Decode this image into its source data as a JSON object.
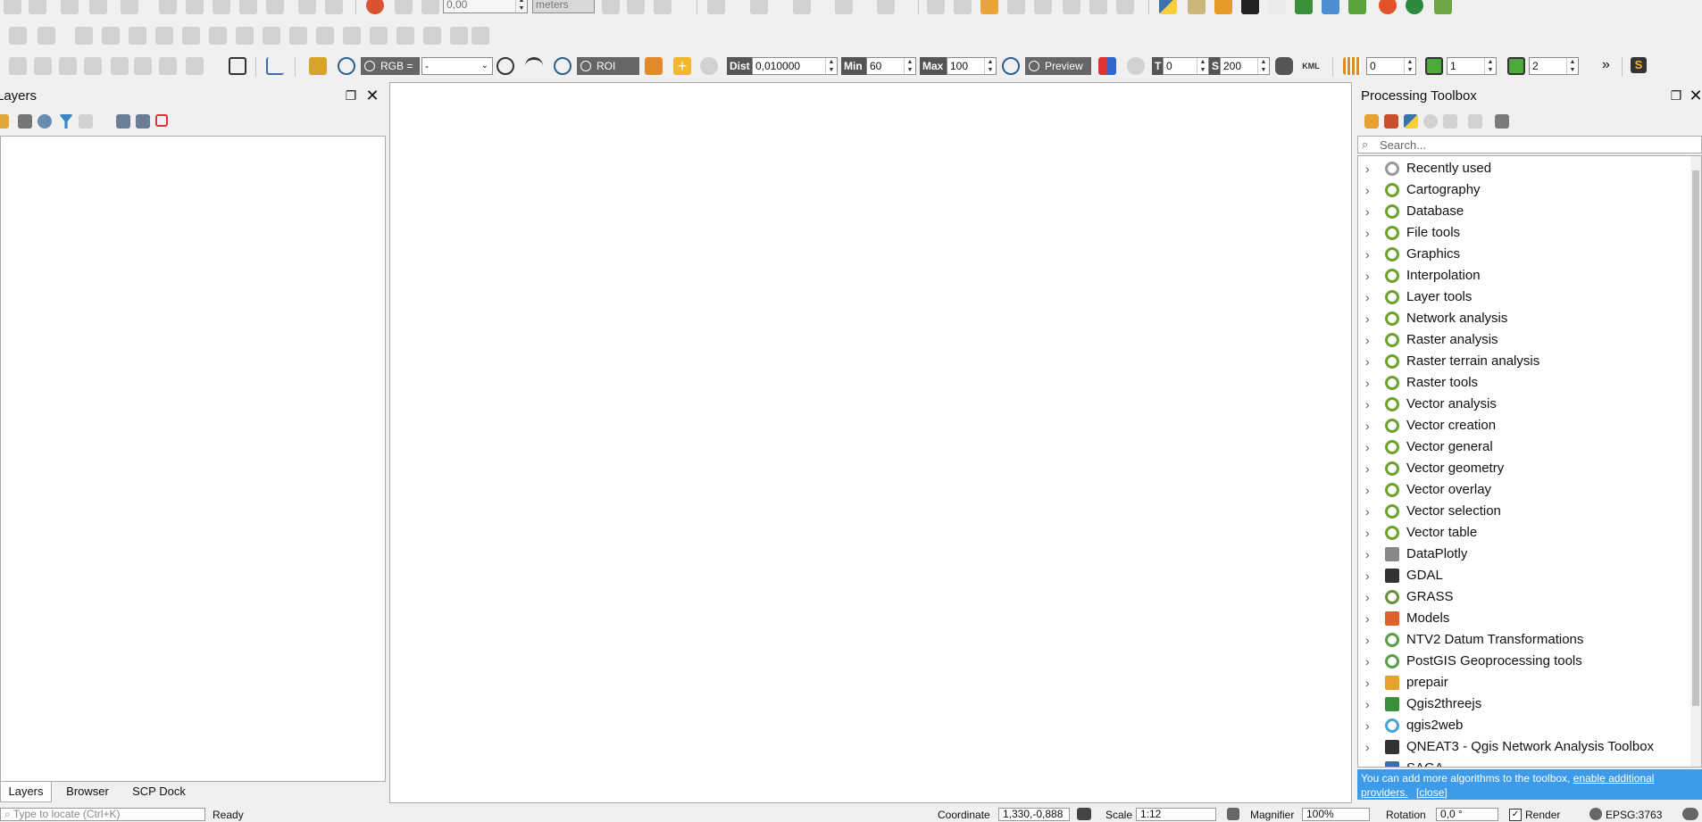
{
  "toolbar_row1": {
    "angle_value": "0,00",
    "unit_value": "meters"
  },
  "toolbar_row3": {
    "rgb_label": "RGB =",
    "rgb_value": "-",
    "roi_label": "ROI",
    "dist_label": "Dist",
    "dist_value": "0,010000",
    "min_label": "Min",
    "min_value": "60",
    "max_label": "Max",
    "max_value": "100",
    "preview_label": "Preview",
    "t_label": "T",
    "t_value": "0",
    "s_label": "S",
    "s_value": "200",
    "kml_label": "KML",
    "band0": "0",
    "band1": "1",
    "band2": "2",
    "more": "»",
    "s_badge": "S"
  },
  "layers_panel": {
    "title": "Layers",
    "tabs": [
      "Layers",
      "Browser",
      "SCP Dock"
    ]
  },
  "toolbox": {
    "title": "Processing Toolbox",
    "search_placeholder": "Search...",
    "items": [
      {
        "label": "Recently used",
        "icon": "clock-icon"
      },
      {
        "label": "Cartography",
        "icon": "qgis-icon"
      },
      {
        "label": "Database",
        "icon": "qgis-icon"
      },
      {
        "label": "File tools",
        "icon": "qgis-icon"
      },
      {
        "label": "Graphics",
        "icon": "qgis-icon"
      },
      {
        "label": "Interpolation",
        "icon": "qgis-icon"
      },
      {
        "label": "Layer tools",
        "icon": "qgis-icon"
      },
      {
        "label": "Network analysis",
        "icon": "qgis-icon"
      },
      {
        "label": "Raster analysis",
        "icon": "qgis-icon"
      },
      {
        "label": "Raster terrain analysis",
        "icon": "qgis-icon"
      },
      {
        "label": "Raster tools",
        "icon": "qgis-icon"
      },
      {
        "label": "Vector analysis",
        "icon": "qgis-icon"
      },
      {
        "label": "Vector creation",
        "icon": "qgis-icon"
      },
      {
        "label": "Vector general",
        "icon": "qgis-icon"
      },
      {
        "label": "Vector geometry",
        "icon": "qgis-icon"
      },
      {
        "label": "Vector overlay",
        "icon": "qgis-icon"
      },
      {
        "label": "Vector selection",
        "icon": "qgis-icon"
      },
      {
        "label": "Vector table",
        "icon": "qgis-icon"
      },
      {
        "label": "DataPlotly",
        "icon": "chart-icon"
      },
      {
        "label": "GDAL",
        "icon": "gdal-icon"
      },
      {
        "label": "GRASS",
        "icon": "grass-icon"
      },
      {
        "label": "Models",
        "icon": "models-icon"
      },
      {
        "label": "NTV2 Datum Transformations",
        "icon": "globe-icon"
      },
      {
        "label": "PostGIS Geoprocessing tools",
        "icon": "globe-icon"
      },
      {
        "label": "prepair",
        "icon": "prepair-icon"
      },
      {
        "label": "Qgis2threejs",
        "icon": "triangle-icon"
      },
      {
        "label": "qgis2web",
        "icon": "gear-icon"
      },
      {
        "label": "QNEAT3 - Qgis Network Analysis Toolbox",
        "icon": "qneat-icon"
      },
      {
        "label": "SAGA",
        "icon": "saga-icon"
      }
    ],
    "info_text": "You can add more algorithms to the toolbox,",
    "info_link": "enable additional providers.",
    "info_close": "[close]"
  },
  "statusbar": {
    "locate_placeholder": "Type to locate (Ctrl+K)",
    "ready": "Ready",
    "coordinate_label": "Coordinate",
    "coordinate_value": "1,330,-0,888",
    "scale_label": "Scale",
    "scale_value": "1:12",
    "magnifier_label": "Magnifier",
    "magnifier_value": "100%",
    "rotation_label": "Rotation",
    "rotation_value": "0,0 °",
    "render_label": "Render",
    "crs_label": "EPSG:3763"
  },
  "colors": {
    "qgis_green": "#6aa12f",
    "info_bar": "#3d9be9",
    "canvas": "#ffffff"
  }
}
